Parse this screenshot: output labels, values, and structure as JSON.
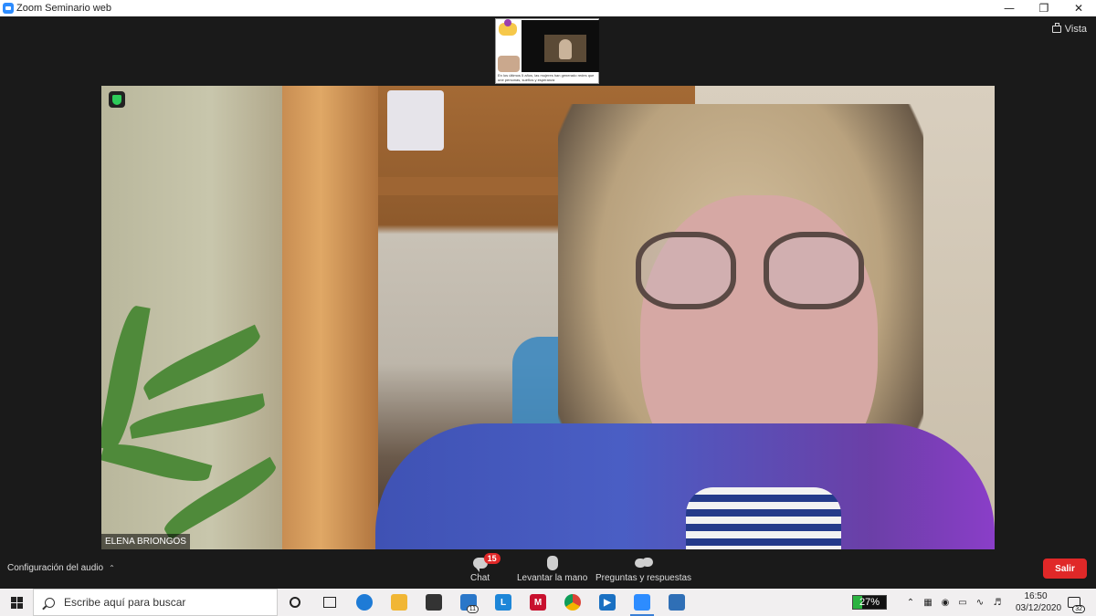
{
  "window": {
    "title": "Zoom Seminario web",
    "controls": [
      "minimize-icon",
      "restore-icon",
      "close-icon"
    ]
  },
  "top": {
    "view_label": "Vista",
    "thumbnail_caption": "En los últimos 5 años, las mujeres han generado redes que une personas, sueños y esperanza"
  },
  "speaker": {
    "name": "ELENA BRIONGOS"
  },
  "toolbar": {
    "audio_label": "Configuración del audio",
    "chat_label": "Chat",
    "chat_badge": "15",
    "raise_hand_label": "Levantar la mano",
    "qa_label": "Preguntas y respuestas",
    "leave_label": "Salir"
  },
  "taskbar": {
    "search_placeholder": "Escribe aquí para buscar",
    "mail_badge": "11",
    "battery_percent": 27,
    "battery_label": "27%",
    "time": "16:50",
    "date": "03/12/2020",
    "notifications_count": "32",
    "colors": {
      "edge": "#1e7bd6",
      "explorer": "#f1b634",
      "store": "#333333",
      "mail": "#2a77c9",
      "l_app": "#1d86d8",
      "mcafee": "#c8102e",
      "chrome": "#2e9e47",
      "movies": "#1a70c2",
      "zoom": "#2d8cff",
      "photos": "#2f6fb6"
    }
  }
}
